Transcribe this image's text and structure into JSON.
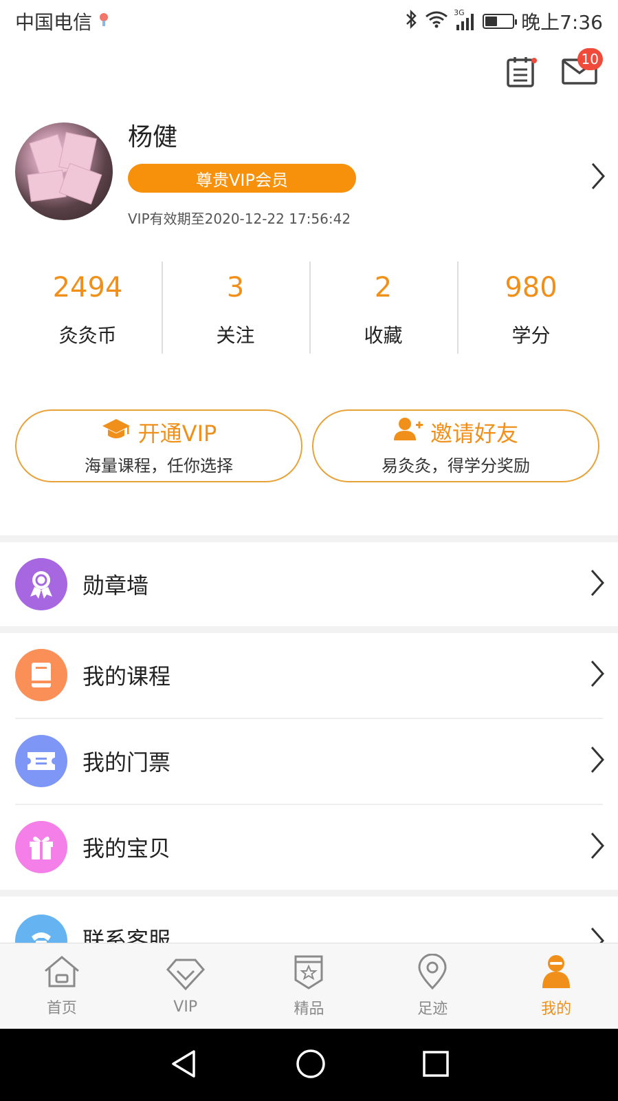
{
  "status_bar": {
    "carrier": "中国电信",
    "network": "3G",
    "time": "晚上7:36",
    "battery_level": 0.45
  },
  "header": {
    "notes_icon": "clipboard-icon",
    "mail_icon": "mail-icon",
    "mail_badge": "10"
  },
  "profile": {
    "name": "杨健",
    "vip_badge": "尊贵VIP会员",
    "vip_expire": "VIP有效期至2020-12-22 17:56:42"
  },
  "stats": [
    {
      "value": "2494",
      "label": "灸灸币"
    },
    {
      "value": "3",
      "label": "关注"
    },
    {
      "value": "2",
      "label": "收藏"
    },
    {
      "value": "980",
      "label": "学分"
    }
  ],
  "actions": {
    "vip": {
      "title": "开通VIP",
      "subtitle": "海量课程，任你选择"
    },
    "invite": {
      "title": "邀请好友",
      "subtitle": "易灸灸，得学分奖励"
    }
  },
  "menu": [
    {
      "label": "勋章墙",
      "icon": "medal-icon",
      "color": "#a667e0"
    },
    {
      "label": "我的课程",
      "icon": "book-icon",
      "color": "#fb8f58"
    },
    {
      "label": "我的门票",
      "icon": "ticket-icon",
      "color": "#7e96f5"
    },
    {
      "label": "我的宝贝",
      "icon": "gift-icon",
      "color": "#f57fe9"
    },
    {
      "label": "联系客服",
      "icon": "phone-icon",
      "color": "#66b3f2"
    }
  ],
  "bottom_nav": [
    {
      "label": "首页",
      "icon": "home-icon"
    },
    {
      "label": "VIP",
      "icon": "diamond-icon"
    },
    {
      "label": "精品",
      "icon": "star-badge-icon"
    },
    {
      "label": "足迹",
      "icon": "location-icon"
    },
    {
      "label": "我的",
      "icon": "user-icon",
      "active": true
    }
  ],
  "colors": {
    "accent": "#f0901a",
    "vip_badge": "#f7900b",
    "badge_red": "#f04a3a"
  }
}
